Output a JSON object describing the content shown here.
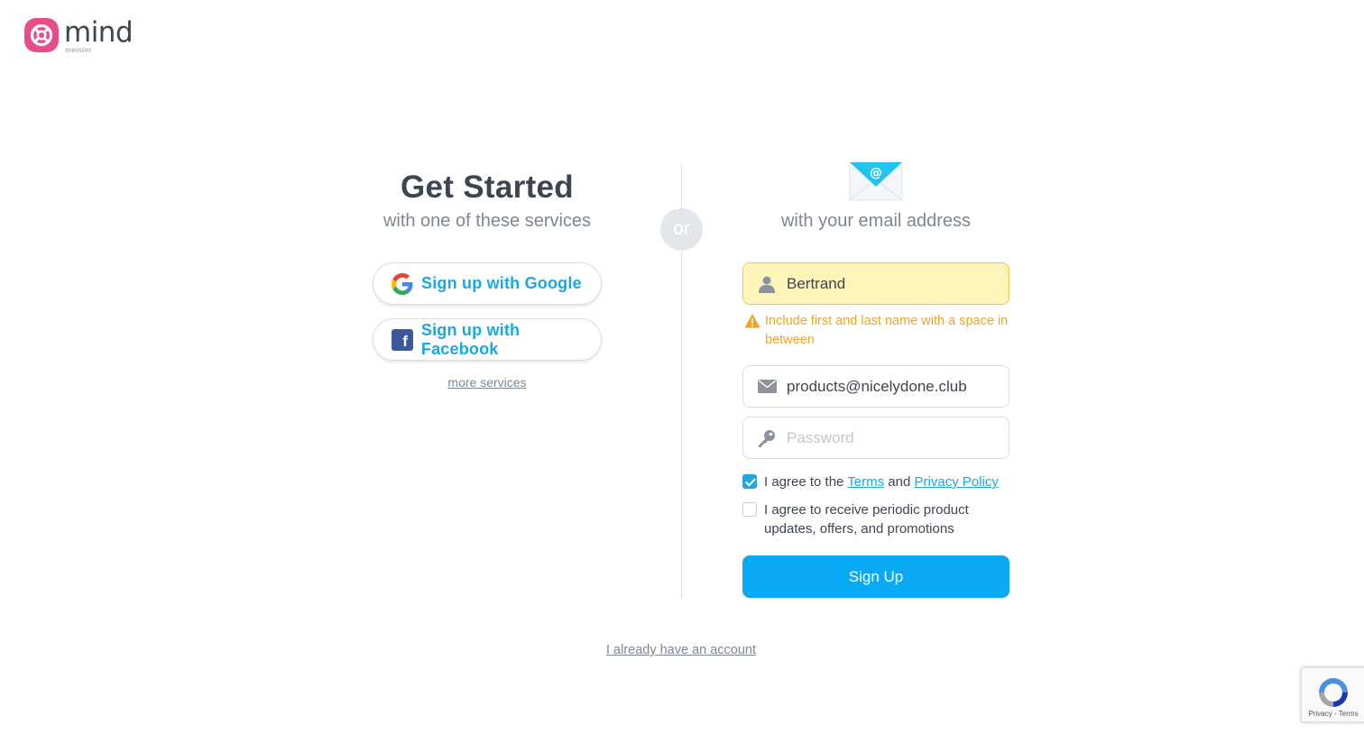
{
  "brand": {
    "name": "mind",
    "sub": "meister",
    "color": "#e94c8a"
  },
  "left": {
    "title": "Get Started",
    "subtitle": "with one of these services",
    "google_label": "Sign up with Google",
    "facebook_label": "Sign up with Facebook",
    "more_services": "more services"
  },
  "divider": {
    "or": "or"
  },
  "right": {
    "subtitle": "with your email address",
    "name_value": "Bertrand",
    "name_warning": "Include first and last name with a space in between",
    "email_value": "products@nicelydone.club",
    "password_placeholder": "Password",
    "terms": {
      "checked": true,
      "prefix": "I agree to the ",
      "terms_link": "Terms",
      "and": " and ",
      "privacy_link": "Privacy Policy"
    },
    "promo": {
      "checked": false,
      "label": "I agree to receive periodic product updates, offers, and promotions"
    },
    "signup_label": "Sign Up"
  },
  "footer": {
    "account_link": "I already have an account"
  },
  "recaptcha": {
    "privacy": "Privacy",
    "sep": " - ",
    "terms": "Terms"
  },
  "colors": {
    "accent": "#1ba7e0",
    "button": "#0aa9f4",
    "warning": "#f0a521",
    "warning_bg": "#fef3b8",
    "facebook": "#3b5998"
  },
  "icons": {
    "logo": "mindmeister-logo-icon",
    "google": "google-icon",
    "facebook": "facebook-icon",
    "envelope": "envelope-at-icon",
    "user": "user-icon",
    "warning": "warning-triangle-icon",
    "mail": "mail-icon",
    "key": "key-icon",
    "recaptcha": "recaptcha-icon"
  }
}
